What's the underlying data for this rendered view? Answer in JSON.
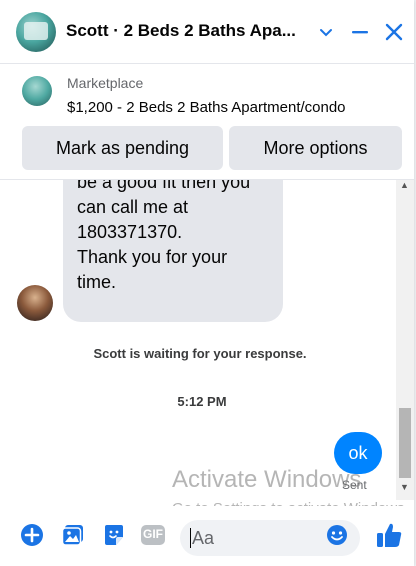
{
  "header": {
    "title": "Scott · 2 Beds 2 Baths Apa...",
    "icons": [
      "chevron-down-icon",
      "minimize-icon",
      "close-icon"
    ]
  },
  "listing": {
    "label": "Marketplace",
    "title": "$1,200 - 2 Beds 2 Baths Apartment/condo",
    "mark_pending": "Mark as pending",
    "more_options": "More options"
  },
  "messages": {
    "incoming_lines": [
      "be a good fit then you",
      "can call me at",
      "1803371370.",
      "Thank you for your",
      "time."
    ],
    "status": "Scott is waiting for your response.",
    "time": "5:12 PM",
    "outgoing": "ok",
    "sent": "Sent"
  },
  "watermark": {
    "line1": "Activate Windows",
    "line2": "Go to Settings to activate Windows."
  },
  "composer": {
    "placeholder": "Aa",
    "gif_label": "GIF"
  },
  "colors": {
    "accent": "#1b74e4",
    "bubble_out": "#0084ff",
    "bubble_in": "#e4e6eb"
  }
}
